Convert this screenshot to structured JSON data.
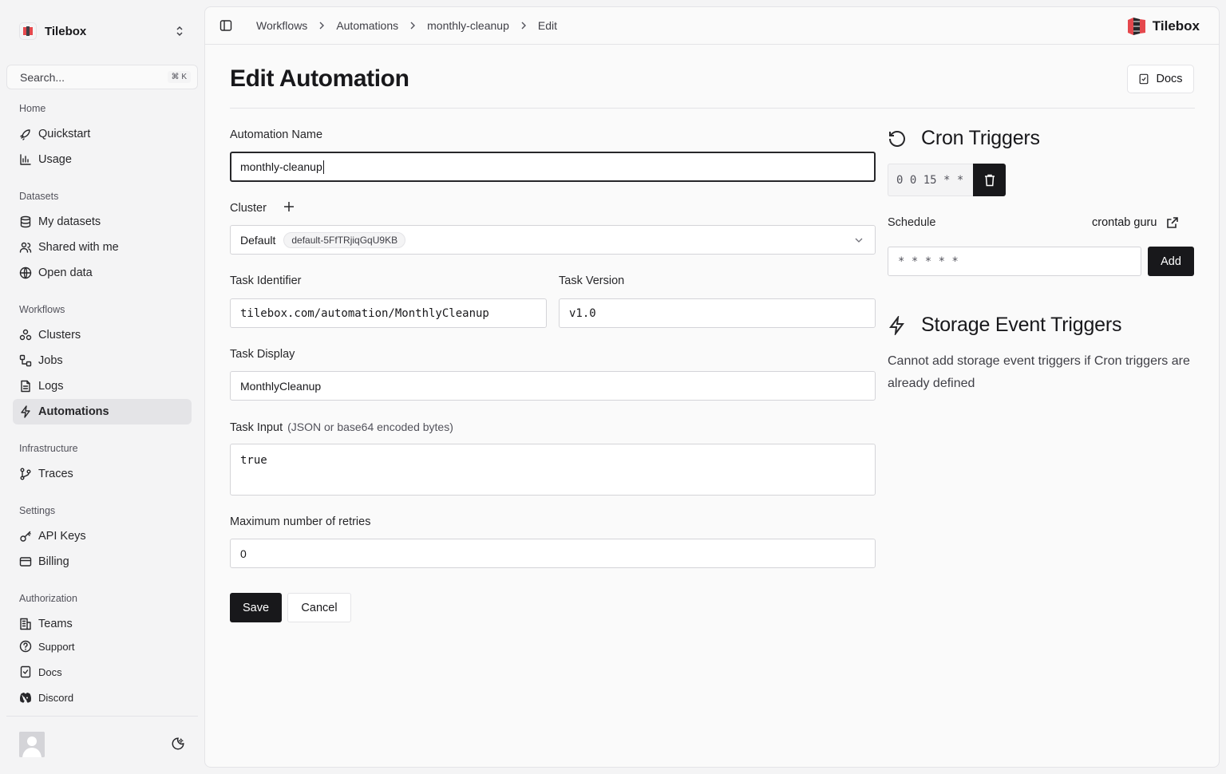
{
  "sidebar": {
    "team_name": "Tilebox",
    "search": {
      "placeholder": "Search...",
      "shortcut": "⌘ K"
    },
    "groups": [
      {
        "label": "Home",
        "items": [
          {
            "label": "Quickstart",
            "icon": "rocket-icon"
          },
          {
            "label": "Usage",
            "icon": "bar-chart-icon"
          }
        ]
      },
      {
        "label": "Datasets",
        "items": [
          {
            "label": "My datasets",
            "icon": "database-icon"
          },
          {
            "label": "Shared with me",
            "icon": "users-icon"
          },
          {
            "label": "Open data",
            "icon": "globe-icon"
          }
        ]
      },
      {
        "label": "Workflows",
        "items": [
          {
            "label": "Clusters",
            "icon": "cluster-icon"
          },
          {
            "label": "Jobs",
            "icon": "workflow-icon"
          },
          {
            "label": "Logs",
            "icon": "log-file-icon"
          },
          {
            "label": "Automations",
            "icon": "zap-icon",
            "active": true
          }
        ]
      },
      {
        "label": "Infrastructure",
        "items": [
          {
            "label": "Traces",
            "icon": "git-branch-icon"
          }
        ]
      },
      {
        "label": "Settings",
        "items": [
          {
            "label": "API Keys",
            "icon": "key-icon"
          },
          {
            "label": "Billing",
            "icon": "credit-card-icon"
          }
        ]
      },
      {
        "label": "Authorization",
        "items": [
          {
            "label": "Teams",
            "icon": "building-icon"
          }
        ]
      }
    ],
    "bottom": [
      {
        "label": "Support",
        "icon": "help-circle-icon"
      },
      {
        "label": "Docs",
        "icon": "book-icon"
      },
      {
        "label": "Discord",
        "icon": "discord-icon"
      }
    ]
  },
  "topbar": {
    "breadcrumbs": [
      "Workflows",
      "Automations",
      "monthly-cleanup",
      "Edit"
    ],
    "brand": "Tilebox"
  },
  "page": {
    "title": "Edit Automation",
    "docs_label": "Docs"
  },
  "form": {
    "name_label": "Automation Name",
    "name_value": "monthly-cleanup",
    "cluster_label": "Cluster",
    "cluster_value": "Default",
    "cluster_badge": "default-5FfTRjiqGqU9KB",
    "task_id_label": "Task Identifier",
    "task_id_value": "tilebox.com/automation/MonthlyCleanup",
    "task_version_label": "Task Version",
    "task_version_value": "v1.0",
    "task_display_label": "Task Display",
    "task_display_value": "MonthlyCleanup",
    "task_input_label": "Task Input",
    "task_input_hint": "(JSON or base64 encoded bytes)",
    "task_input_value": "true",
    "retries_label": "Maximum number of retries",
    "retries_value": "0",
    "save_label": "Save",
    "cancel_label": "Cancel"
  },
  "cron": {
    "title": "Cron Triggers",
    "existing": "0 0 15 * *",
    "schedule_label": "Schedule",
    "crontab_link": "crontab guru",
    "schedule_placeholder": "* * * * *",
    "add_label": "Add"
  },
  "storage": {
    "title": "Storage Event Triggers",
    "note": "Cannot add storage event triggers if Cron triggers are already defined"
  },
  "colors": {
    "primary": "#18181b",
    "brand_red": "#e5484d",
    "active_bg": "#e4e4e7"
  }
}
